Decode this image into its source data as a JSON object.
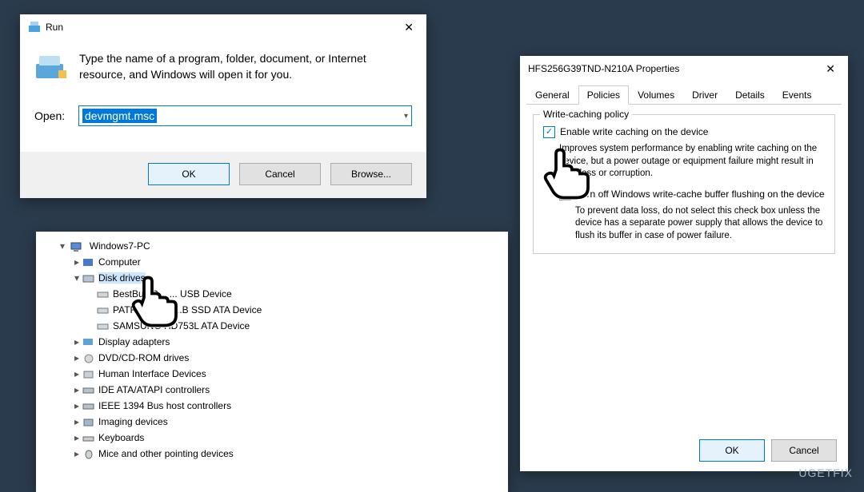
{
  "run": {
    "title": "Run",
    "description": "Type the name of a program, folder, document, or Internet resource, and Windows will open it for you.",
    "open_label": "Open:",
    "input_value": "devmgmt.msc",
    "buttons": {
      "ok": "OK",
      "cancel": "Cancel",
      "browse": "Browse..."
    }
  },
  "tree": {
    "root": "Windows7-PC",
    "computer": "Computer",
    "disk_drives": "Disk drives",
    "drives": [
      "BestBuy G...          ... USB Device",
      "PATRIOT M...          ...B SSD ATA Device",
      "SAMSUNG HD753L ATA Device"
    ],
    "rest": [
      "Display adapters",
      "DVD/CD-ROM drives",
      "Human Interface Devices",
      "IDE ATA/ATAPI controllers",
      "IEEE 1394 Bus host controllers",
      "Imaging devices",
      "Keyboards",
      "Mice and other pointing devices"
    ]
  },
  "props": {
    "title": "HFS256G39TND-N210A Properties",
    "tabs": [
      "General",
      "Policies",
      "Volumes",
      "Driver",
      "Details",
      "Events"
    ],
    "active_tab": "Policies",
    "group_title": "Write-caching policy",
    "chk1_label": "Enable write caching on the device",
    "chk1_desc": "Improves system performance by enabling write caching on the device, but a power outage or equipment failure might result in data loss or corruption.",
    "chk2_desc_a": "Turn off Windows write-cache buffer flushing on the device",
    "chk2_desc_b": "To prevent data loss, do not select this check box unless the device has a separate power supply that allows the device to flush its buffer in case of power failure.",
    "ok": "OK",
    "cancel": "Cancel"
  },
  "watermark": "UGETFIX"
}
